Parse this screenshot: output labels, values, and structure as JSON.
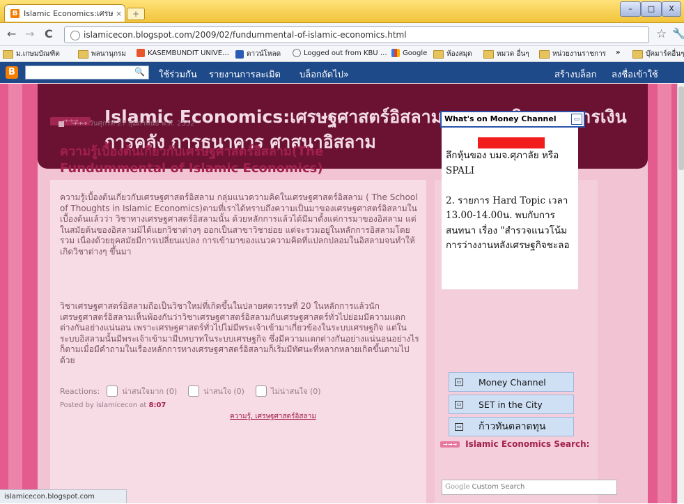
{
  "browser": {
    "tab_title": "Islamic Economics:เศรษฐศาสต",
    "tab_close": "×",
    "url": "islamicecon.blogspot.com/2009/02/fundummental-of-islamic-economics.html",
    "status_url": "islamicecon.blogspot.com",
    "back": "←",
    "forward": "→",
    "reload": "C",
    "star": "☆",
    "wrench": "🔧",
    "minimize": "–",
    "maximize": "□",
    "close": "X",
    "bookmarks": [
      {
        "label": "ม.เกษมบัณฑิต",
        "icon": "folder-icon"
      },
      {
        "label": "พลนานุกรม",
        "icon": "folder-icon"
      },
      {
        "label": "KASEMBUNDIT UNIVE…",
        "icon": "kbu-icon"
      },
      {
        "label": "ดาวน์โหลด",
        "icon": "download-icon"
      },
      {
        "label": "Logged out from KBU …",
        "icon": "globe-icon"
      },
      {
        "label": "Google",
        "icon": "google-icon"
      },
      {
        "label": "ห้องสมุด",
        "icon": "folder-icon"
      },
      {
        "label": "หมวด อื่นๆ",
        "icon": "folder-icon"
      },
      {
        "label": "หน่วยงานราชการ",
        "icon": "folder-icon"
      },
      {
        "label": "»",
        "icon": ""
      },
      {
        "label": "บุ๊คมาร์คอื่นๆ",
        "icon": "folder-icon"
      }
    ]
  },
  "blogger_nav": {
    "logo": "B",
    "share": "ใช้ร่วมกัน",
    "report": "รายงานการละเมิด",
    "next_blog": "บล็อกถัดไป»",
    "create_blog": "สร้างบล็อก",
    "sign_in": "ลงชื่อเข้าใช้"
  },
  "blog": {
    "header_tag": "→→→",
    "title": "Islamic Economics:เศรษฐศาสตร์อิสลาม ธนาคารอิสลาม การเงินการคลัง การธนาคาร ศาสนาอิสลาม"
  },
  "post": {
    "date": "วันศุกร์ที่ 27 กุมภาพันธ์ พ.ศ. 2552",
    "title": "ความรู้เบื้องต้นเกี่ยวกับเศรษฐศาสตร์อิสลาม(The Fundummental of Islamic Economics)",
    "para1": "ความรู้เบื้องต้นเกี่ยวกับเศรษฐศาสตร์อิสลาม กลุ่มแนวความคิดในเศรษฐศาสตร์อิสลาม ( The School of Thoughts in Islamic Economics)ตามที่เราได้ทราบถึงความเป็นมาของเศรษฐศาสตร์อิสลามในเบื้องต้นแล้วว่า วิชาทางเศรษฐศาสตร์อิสลามนั้น ด้วยหลักการแล้วได้มีมาตั้งแต่การมาของอิสลาม แต่ในสมัยต้นของอิสลามมิได้แยกวิชาต่างๆ ออกเป็นสาขาวิชาย่อย แต่จะรวมอยู่ในหลักการอิสลามโดยรวม เนื่องด้วยยุคสมัยมีการเปลี่ยนแปลง การเข้ามาของแนวความคิดที่แปลกปลอมในอิสลามจนทำให้เกิดวิชาต่างๆ ขึ้นมา",
    "para2": "วิชาเศรษฐศาสตร์อิสลามถือเป็นวิชาใหม่ที่เกิดขึ้นในปลายศตวรรษที่ 20 ในหลักการแล้วนักเศรษฐศาสตร์อิสลามเห็นพ้องกันว่าวิชาเศรษฐศาสตร์อิสลามกับเศรษฐศาสตร์ทั่วไปย่อมมีความแตกต่างกันอย่างแน่นอน เพราะเศรษฐศาสตร์ทั่วไปไม่มีพระเจ้าเข้ามาเกี่ยวข้องในระบบเศรษฐกิจ แต่ในระบบอิสลามนั้นมีพระเจ้าเข้ามามีบทบาทในระบบเศรษฐกิจ ซึ่งมีความแตกต่างกันอย่างแน่นอนอย่างไรก็ตามเมื่อมีคำถามในเรื่องหลักการทางเศรษฐศาสตร์อิสลามก็เริ่มมีทัศนะที่หลากหลายเกิดขึ้นตามไปด้วย",
    "reactions_label": "Reactions:",
    "reactions": [
      {
        "label": "น่าสนใจมาก (0)"
      },
      {
        "label": "น่าสนใจ (0)"
      },
      {
        "label": "ไม่น่าสนใจ (0)"
      }
    ],
    "posted_prefix": "Posted by islamicecon at",
    "posted_time": "8:07",
    "labels": "ความรู้, เศรษฐศาสตร์อิสลาม"
  },
  "sidebar": {
    "widget_title": "What's on Money Channel",
    "widget_text": "ลึกหุ้นของ บมจ.ศุภาลัย หรือ SPALI\n\n2. รายการ Hard Topic เวลา 13.00-14.00น. พบกับการสนทนา เรื่อง \"สำรวจแนวโน้มการว่างงานหลังเศรษฐกิจชะลอ",
    "links": [
      "Money Channel",
      "SET in the City",
      "ก้าวทันตลาดทุน"
    ],
    "search_title": "Islamic Economics Search:",
    "search_arrow": "→→→",
    "search_placeholder": "Custom Search",
    "google": "Google"
  }
}
